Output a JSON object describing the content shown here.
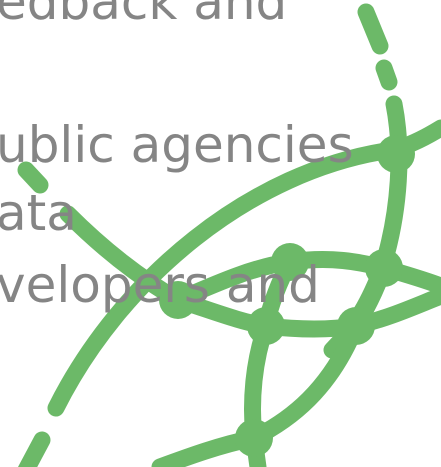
{
  "slide": {
    "lines": [
      "edback and",
      "ublic agencies",
      "ata",
      "velopers and"
    ]
  },
  "decoration": {
    "name": "green-network-arcs",
    "color": "#6cb968"
  }
}
